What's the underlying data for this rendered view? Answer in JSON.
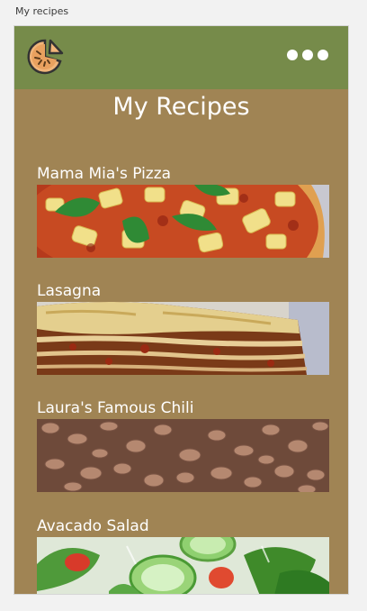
{
  "window": {
    "title": "My recipes"
  },
  "header": {
    "logo_icon": "pie-logo-icon",
    "menu_icon": "more-dots-icon"
  },
  "page": {
    "title": "My Recipes"
  },
  "recipes": [
    {
      "name": "Mama Mia's Pizza",
      "image": "pizza"
    },
    {
      "name": "Lasagna",
      "image": "lasagna"
    },
    {
      "name": "Laura's Famous Chili",
      "image": "chili-beans"
    },
    {
      "name": "Avacado Salad",
      "image": "salad"
    }
  ],
  "colors": {
    "header": "#768b4a",
    "body": "#a08454",
    "text": "#ffffff"
  }
}
